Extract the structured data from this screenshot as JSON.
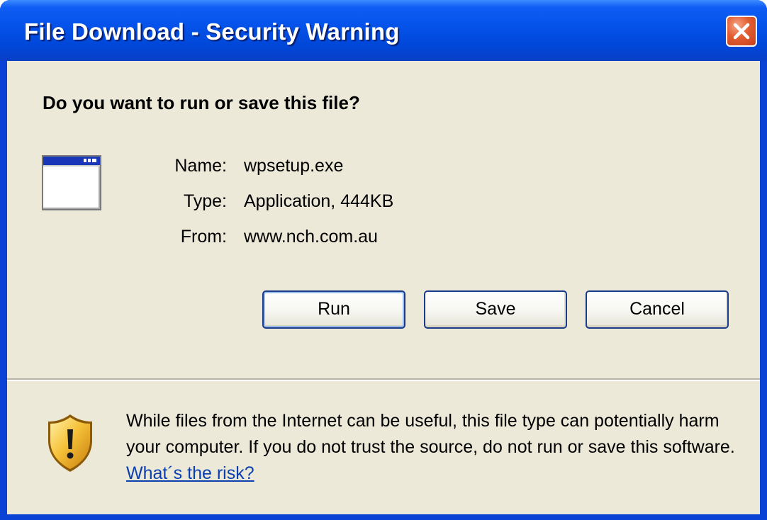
{
  "window": {
    "title": "File Download - Security Warning",
    "close_icon": "close-icon"
  },
  "dialog": {
    "question": "Do you want to run or save this file?",
    "file_icon": "application-window-icon",
    "fields": [
      {
        "label": "Name:",
        "value": "wpsetup.exe"
      },
      {
        "label": "Type:",
        "value": "Application, 444KB"
      },
      {
        "label": "From:",
        "value": "www.nch.com.au"
      }
    ]
  },
  "buttons": {
    "run": "Run",
    "save": "Save",
    "cancel": "Cancel"
  },
  "warning": {
    "icon": "warning-shield-icon",
    "text": "While files from the Internet can be useful, this file type can potentially harm your computer. If you do not trust the source, do not run or save this software.",
    "link": "What´s the risk?"
  },
  "colors": {
    "titlebar": "#0553ea",
    "client_bg": "#ece9d8",
    "close_button": "#e25c30",
    "link": "#0b3fb0"
  }
}
